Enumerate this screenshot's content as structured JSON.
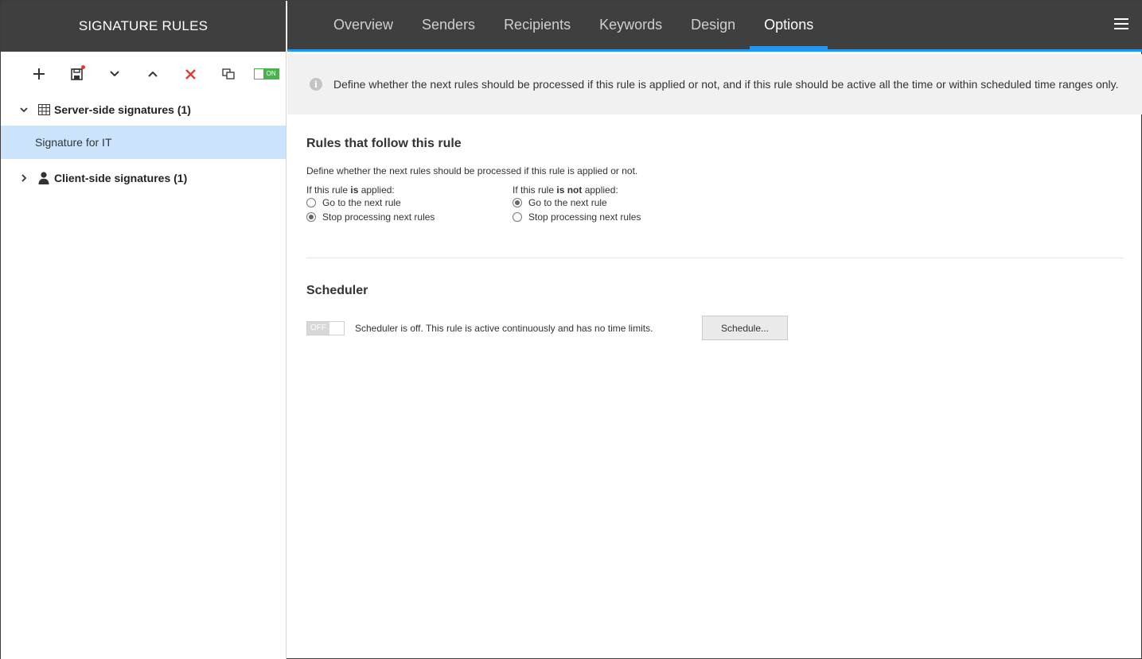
{
  "sidebar": {
    "title": "SIGNATURE RULES",
    "toolbar": {
      "toggle_label": "ON",
      "icons": [
        "plus-icon",
        "save-icon",
        "chevron-down-icon",
        "chevron-up-icon",
        "close-icon",
        "duplicate-icon"
      ]
    },
    "groups": [
      {
        "label": "Server-side signatures (1)",
        "expanded": true,
        "items": [
          "Signature for IT"
        ]
      },
      {
        "label": "Client-side signatures (1)",
        "expanded": false
      }
    ]
  },
  "nav": {
    "tabs": [
      "Overview",
      "Senders",
      "Recipients",
      "Keywords",
      "Design",
      "Options"
    ],
    "active_tab": "Options"
  },
  "info": {
    "text": "Define whether the next rules should be processed if this rule is applied or not, and if this rule should be active all the time or within scheduled time ranges only."
  },
  "rules_section": {
    "title": "Rules that follow this rule",
    "description": "Define whether the next rules should be processed if this rule is applied or not.",
    "applied": {
      "label_prefix": "If this rule ",
      "label_bold": "is",
      "label_suffix": " applied:",
      "options": [
        "Go to the next rule",
        "Stop processing next rules"
      ],
      "selected": 1
    },
    "not_applied": {
      "label_prefix": "If this rule ",
      "label_bold": "is not",
      "label_suffix": " applied:",
      "options": [
        "Go to the next rule",
        "Stop processing next rules"
      ],
      "selected": 0
    }
  },
  "scheduler": {
    "title": "Scheduler",
    "toggle_label": "OFF",
    "status_text": "Scheduler is off. This rule is active continuously and has no time limits.",
    "button_label": "Schedule..."
  },
  "colors": {
    "accent": "#2196f3",
    "header_bg": "#3f3f3f",
    "selected_item_bg": "#cce4fb",
    "toggle_on": "#4caf50",
    "delete_red": "#e53935"
  }
}
